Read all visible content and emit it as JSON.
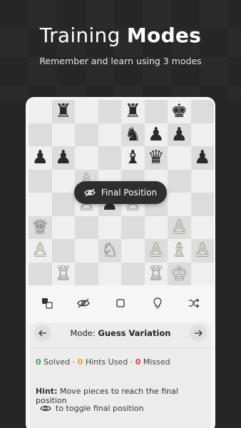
{
  "header": {
    "title_light": "Training ",
    "title_bold": "Modes",
    "subtitle": "Remember and learn using 3 modes"
  },
  "board": {
    "rows": [
      [
        "",
        "♜",
        "",
        "",
        "♜",
        "",
        "♚",
        ""
      ],
      [
        "",
        "",
        "",
        "",
        "♞",
        "♟",
        "♟",
        ""
      ],
      [
        "♟",
        "♟",
        "",
        "",
        "♝",
        "♛",
        "",
        "♟"
      ],
      [
        "",
        "",
        "♙",
        "",
        "",
        "",
        "",
        ""
      ],
      [
        "",
        "",
        "♙",
        "♟",
        "♙",
        "",
        "",
        ""
      ],
      [
        "♕",
        "",
        "",
        "",
        "",
        "",
        "♙",
        ""
      ],
      [
        "♙",
        "",
        "",
        "♘",
        "",
        "♙",
        "♗",
        "♙"
      ],
      [
        "",
        "♖",
        "",
        "",
        "",
        "♖",
        "♔",
        ""
      ]
    ]
  },
  "tooltip": {
    "icon": "eye-off-icon",
    "label": "Final Position"
  },
  "toolbar": {
    "icons": [
      "swap-colors-icon",
      "eye-off-icon",
      "stop-icon",
      "lightbulb-icon",
      "shuffle-icon"
    ]
  },
  "panel": {
    "mode_prefix": "Mode: ",
    "mode_value": "Guess Variation",
    "solved_count": "0",
    "solved_label": " Solved · ",
    "hints_count": "0",
    "hints_label": " Hints Used · ",
    "missed_count": "0",
    "missed_label": " Missed",
    "hint_prefix": "Hint:",
    "hint_text": " Move pieces to reach the final position",
    "hint2_text": "to toggle final position"
  },
  "colors": {
    "background": "#262626",
    "solved": "#3aa35a",
    "hints": "#e0a526",
    "missed": "#d9433b"
  }
}
